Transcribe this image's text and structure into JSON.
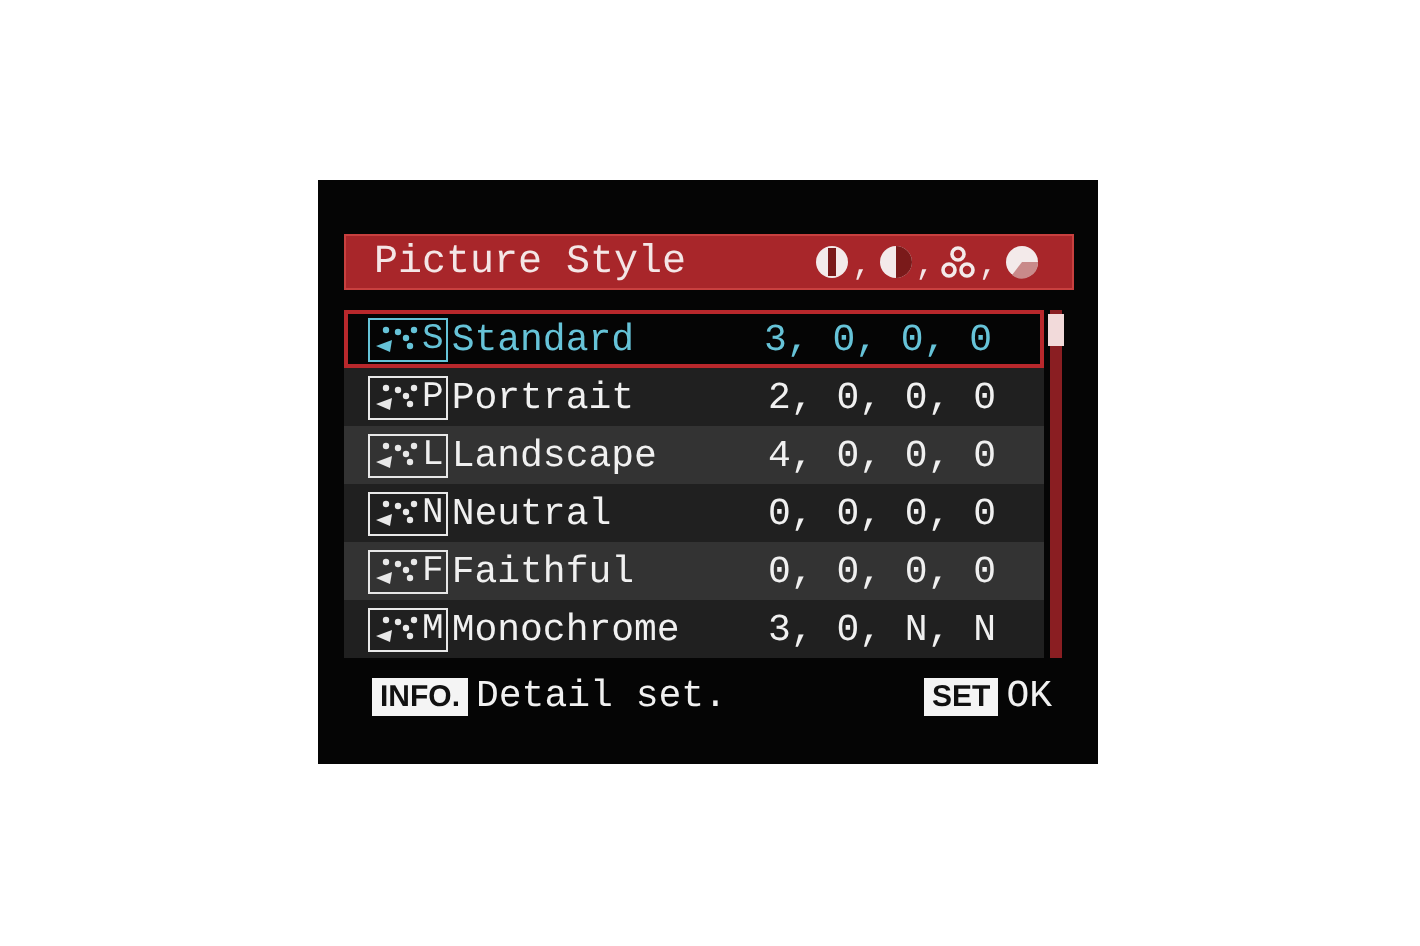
{
  "header": {
    "title": "Picture Style",
    "separators": [
      ",",
      ",",
      ","
    ]
  },
  "styles": [
    {
      "code": "S",
      "name": "Standard",
      "values": "3, 0, 0, 0",
      "selected": true
    },
    {
      "code": "P",
      "name": "Portrait",
      "values": "2, 0, 0, 0",
      "selected": false
    },
    {
      "code": "L",
      "name": "Landscape",
      "values": "4, 0, 0, 0",
      "selected": false
    },
    {
      "code": "N",
      "name": "Neutral",
      "values": "0, 0, 0, 0",
      "selected": false
    },
    {
      "code": "F",
      "name": "Faithful",
      "values": "0, 0, 0, 0",
      "selected": false
    },
    {
      "code": "M",
      "name": "Monochrome",
      "values": "3, 0, N, N",
      "selected": false
    }
  ],
  "footer": {
    "info_key": "INFO.",
    "info_label": "Detail set.",
    "set_key": "SET",
    "set_label": "OK"
  }
}
